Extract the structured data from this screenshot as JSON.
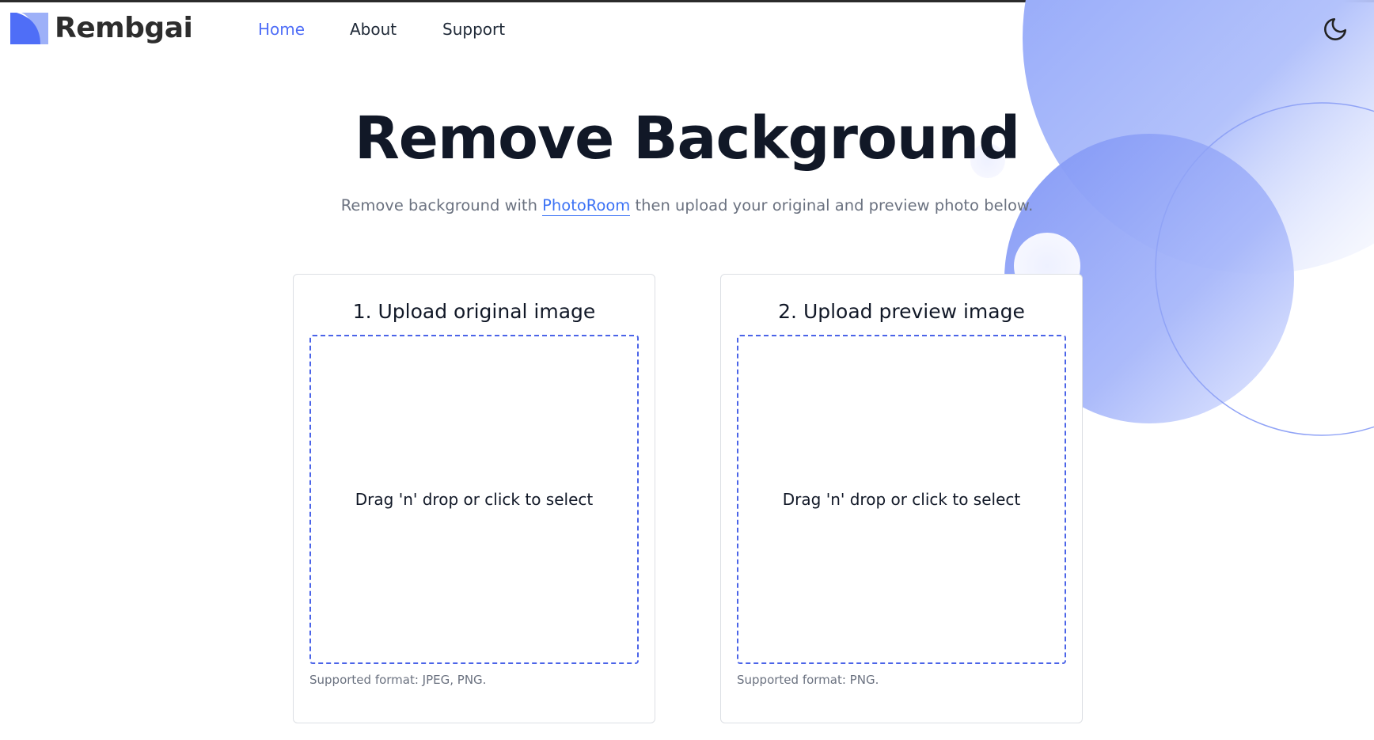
{
  "brand": {
    "name": "Rembgai"
  },
  "nav": {
    "items": [
      "Home",
      "About",
      "Support"
    ],
    "active": "Home"
  },
  "hero": {
    "title": "Remove Background",
    "subtitle_before": "Remove background with ",
    "subtitle_link": "PhotoRoom",
    "subtitle_after": " then upload your original and preview photo below."
  },
  "upload_original": {
    "title": "1. Upload original image",
    "dropzone_text": "Drag 'n' drop or click to select",
    "format_note": "Supported format: JPEG, PNG."
  },
  "upload_preview": {
    "title": "2. Upload preview image",
    "dropzone_text": "Drag 'n' drop or click to select",
    "format_note": "Supported format: PNG."
  },
  "icons": {
    "theme_toggle": "moon-icon",
    "logo": "logo-icon"
  },
  "colors": {
    "accent": "#4f6ef7",
    "link": "#3d73f5",
    "dropzone_border": "#4b64e8"
  }
}
